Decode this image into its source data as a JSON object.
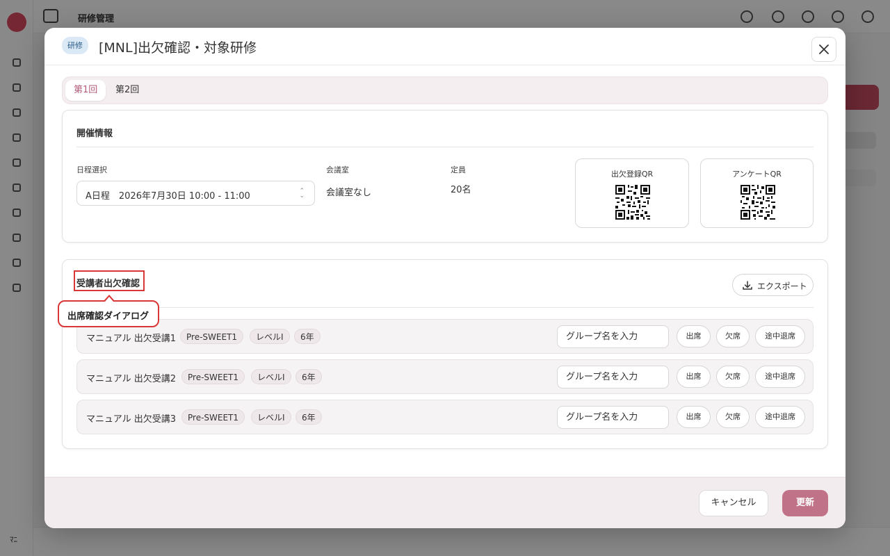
{
  "background": {
    "app_title": "研修管理",
    "workspace_label": "ﾏﾆ"
  },
  "dialog": {
    "tag": "研修",
    "title": "[MNL]出欠確認・対象研修",
    "tabs": [
      {
        "label": "第1回",
        "active": true
      },
      {
        "label": "第2回",
        "active": false
      }
    ],
    "info": {
      "section_title": "開催情報",
      "schedule_label": "日程選択",
      "schedule_value": "A日程　2026年7月30日 10:00 - 11:00",
      "room_label": "会議室",
      "room_value": "会議室なし",
      "capacity_label": "定員",
      "capacity_value": "20名",
      "qr_attendance_label": "出欠登録QR",
      "qr_survey_label": "アンケートQR"
    },
    "attendance": {
      "section_title": "受講者出欠確認",
      "export_label": "エクスポート",
      "group_placeholder": "グループ名を入力",
      "btn_present": "出席",
      "btn_absent": "欠席",
      "btn_leave": "途中退席",
      "rows": [
        {
          "name": "マニュアル 出欠受講1",
          "chips": [
            "Pre-SWEET1",
            "レベルI",
            "6年"
          ]
        },
        {
          "name": "マニュアル 出欠受講2",
          "chips": [
            "Pre-SWEET1",
            "レベルI",
            "6年"
          ]
        },
        {
          "name": "マニュアル 出欠受講3",
          "chips": [
            "Pre-SWEET1",
            "レベルI",
            "6年"
          ]
        }
      ]
    },
    "footer": {
      "cancel_label": "キャンセル",
      "update_label": "更新"
    }
  },
  "annotation": {
    "tooltip": "出席確認ダイアログ"
  },
  "colors": {
    "accent": "#b25a76",
    "update_button": "#c07388",
    "highlight": "#d93636",
    "tag_bg": "#dbe9f6"
  }
}
